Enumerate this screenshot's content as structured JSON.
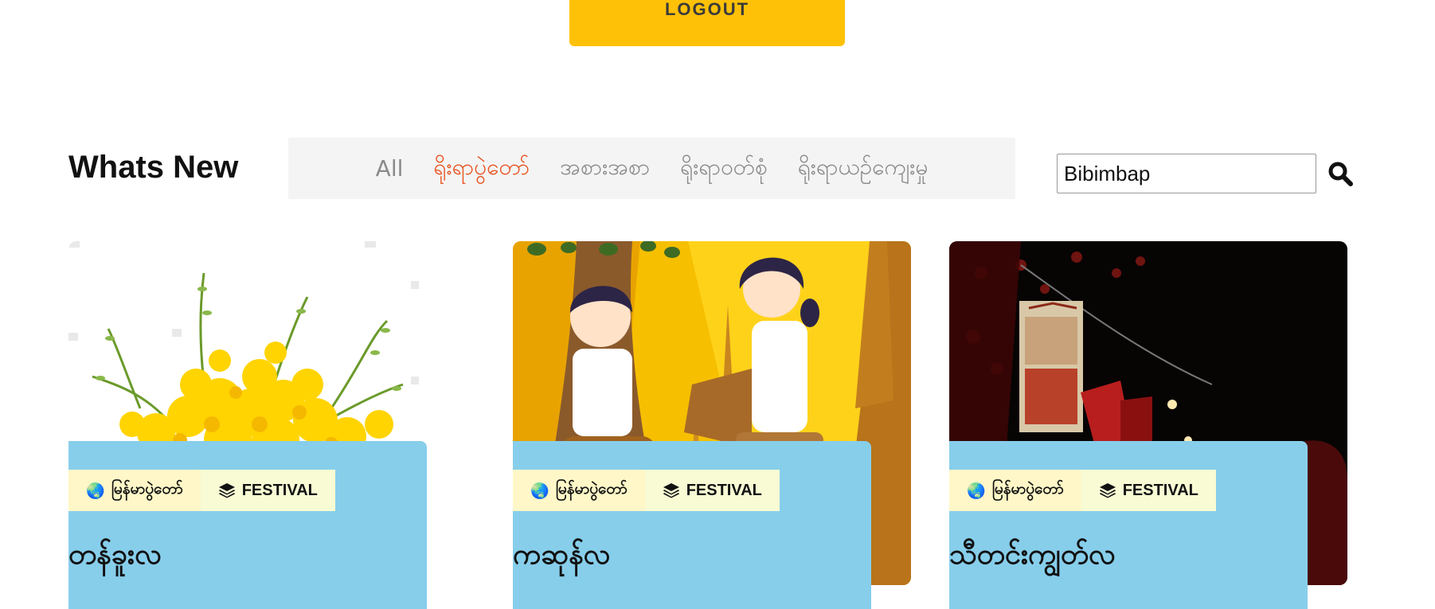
{
  "header": {
    "logout_label": "LOGOUT"
  },
  "section": {
    "title": "Whats New",
    "tabs": [
      {
        "label": "All",
        "active": false
      },
      {
        "label": "ရိုးရာပွဲတော်",
        "active": true
      },
      {
        "label": "အစားအစာ",
        "active": false
      },
      {
        "label": "ရိုးရာဝတ်စုံ",
        "active": false
      },
      {
        "label": "ရိုးရာယဉ်ကျေးမှု",
        "active": false
      }
    ]
  },
  "search": {
    "value": "Bibimbap",
    "icon": "search-icon"
  },
  "cards": [
    {
      "region": "မြန်မာပွဲတော်",
      "category": "FESTIVAL",
      "title": "တန်ခူးလ",
      "image": "yellow-flowers"
    },
    {
      "region": "မြန်မာပွဲတော်",
      "category": "FESTIVAL",
      "title": "ကဆုန်လ",
      "image": "bodhi-tree-watering"
    },
    {
      "region": "မြန်မာပွဲတော်",
      "category": "FESTIVAL",
      "title": "သီတင်းကျွတ်လ",
      "image": "lanterns-night"
    }
  ],
  "colors": {
    "accent": "#ffc107",
    "active_tab": "#e8531f",
    "card_panel": "#87ceeb"
  }
}
